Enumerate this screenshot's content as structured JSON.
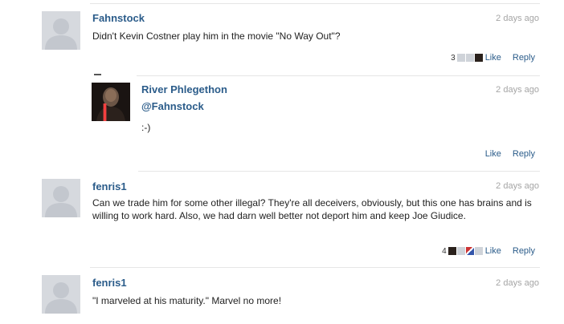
{
  "comments": [
    {
      "author": "Fahnstock",
      "timestamp": "2 days ago",
      "body": "Didn't Kevin Costner play him in the movie \"No Way Out\"?",
      "like_count": "3",
      "like_label": "Like",
      "reply_label": "Reply"
    },
    {
      "author": "River Phlegethon",
      "timestamp": "2 days ago",
      "mention": "@Fahnstock",
      "body": ":-)",
      "like_label": "Like",
      "reply_label": "Reply"
    },
    {
      "author": "fenris1",
      "timestamp": "2 days ago",
      "body": "Can we trade him for some other illegal? They're all deceivers, obviously, but this one has brains and is willing to work hard. Also, we had darn well better not deport him and keep Joe Giudice.",
      "like_count": "4",
      "like_label": "Like",
      "reply_label": "Reply"
    },
    {
      "author": "fenris1",
      "timestamp": "2 days ago",
      "body": "\"I marveled at his maturity.\" Marvel no more!"
    }
  ]
}
